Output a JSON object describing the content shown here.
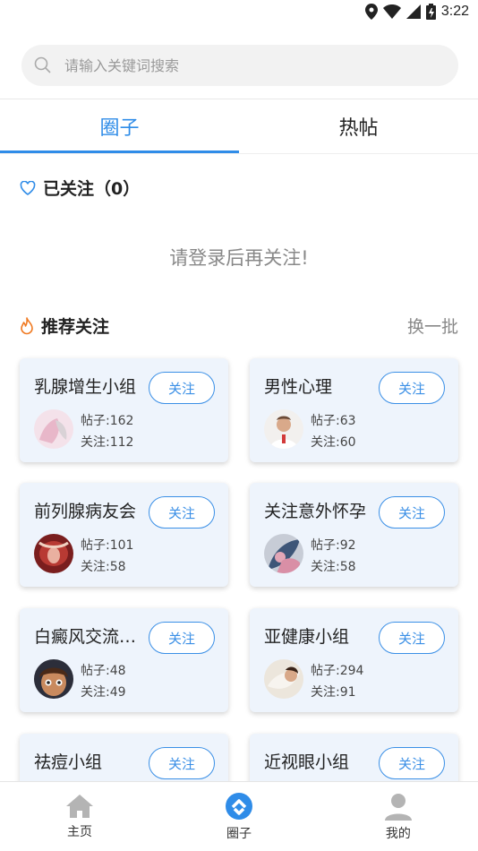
{
  "status_bar": {
    "time": "3:22",
    "icons": [
      "location-icon",
      "wifi-icon",
      "signal-icon",
      "battery-icon"
    ]
  },
  "search": {
    "placeholder": "请输入关键词搜索"
  },
  "tabs": [
    {
      "label": "圈子",
      "active": true
    },
    {
      "label": "热帖",
      "active": false
    }
  ],
  "followed": {
    "title": "已关注（0）",
    "empty_tip": "请登录后再关注!"
  },
  "recommend": {
    "title": "推荐关注",
    "refresh_label": "换一批"
  },
  "cards": [
    {
      "name": "乳腺增生小组",
      "button": "关注",
      "posts": "帖子:162",
      "follows": "关注:112"
    },
    {
      "name": "男性心理",
      "button": "关注",
      "posts": "帖子:63",
      "follows": "关注:60"
    },
    {
      "name": "前列腺病友会",
      "button": "关注",
      "posts": "帖子:101",
      "follows": "关注:58"
    },
    {
      "name": "关注意外怀孕",
      "button": "关注",
      "posts": "帖子:92",
      "follows": "关注:58"
    },
    {
      "name": "白癜风交流…",
      "button": "关注",
      "posts": "帖子:48",
      "follows": "关注:49"
    },
    {
      "name": "亚健康小组",
      "button": "关注",
      "posts": "帖子:294",
      "follows": "关注:91"
    },
    {
      "name": "祛痘小组",
      "button": "关注",
      "posts": "",
      "follows": ""
    },
    {
      "name": "近视眼小组",
      "button": "关注",
      "posts": "",
      "follows": ""
    }
  ],
  "bottom_nav": [
    {
      "label": "主页",
      "icon": "home-icon"
    },
    {
      "label": "圈子",
      "icon": "circle-icon",
      "active": true
    },
    {
      "label": "我的",
      "icon": "profile-icon"
    }
  ],
  "colors": {
    "accent": "#2f8ce8",
    "card_bg": "#eef4fc",
    "fire": "#f07a22"
  }
}
